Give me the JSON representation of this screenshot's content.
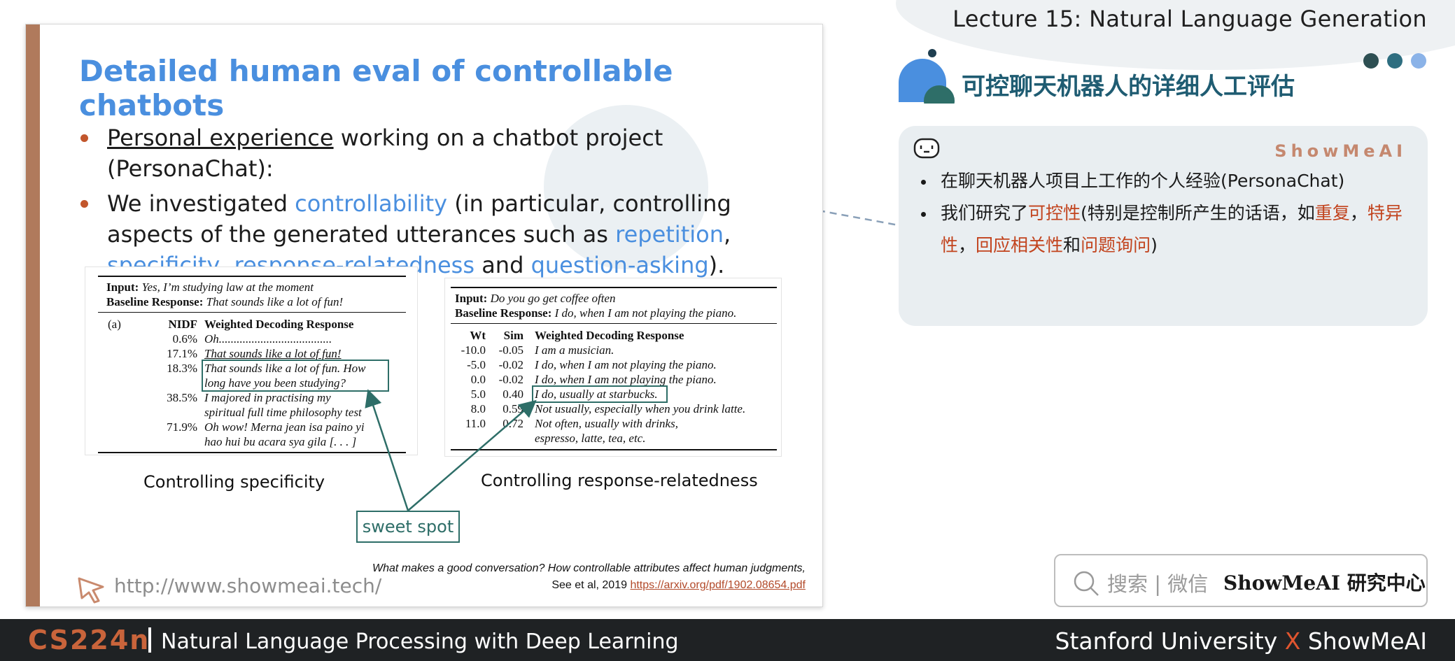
{
  "header": {
    "lecture_title": "Lecture 15: Natural Language Generation"
  },
  "slide": {
    "title": "Detailed human eval of controllable chatbots",
    "bullet1": {
      "underlined": "Personal experience",
      "rest": " working on a chatbot project (PersonaChat):"
    },
    "bullet2": {
      "t1": "We investigated ",
      "controllability": "controllability",
      "t2": " (in particular, controlling aspects of the generated utterances such as ",
      "repetition": "repetition",
      "comma1": ", ",
      "specificity": "specificity",
      "comma2": ", ",
      "relatedness": "response-relatedness",
      "and": " and ",
      "question": "question-asking",
      "end": ")."
    },
    "table_a": {
      "input_label": "Input:",
      "input_text": "Yes, I’m studying law at the moment",
      "baseline_label": "Baseline Response:",
      "baseline_text": "That sounds like a lot of fun!",
      "col_a": "(a)",
      "col_nidf": "NIDF",
      "col_resp": "Weighted Decoding Response",
      "rows": [
        {
          "nidf": "0.6%",
          "l1": "Oh......................................",
          "l2": ""
        },
        {
          "nidf": "17.1%",
          "l1": "That sounds like a lot of fun!",
          "l2": ""
        },
        {
          "nidf": "18.3%",
          "l1": "That sounds like a lot of fun. How",
          "l2": "long have you been studying?"
        },
        {
          "nidf": "38.5%",
          "l1": "I majored in practising my",
          "l2": "spiritual full time philosophy test"
        },
        {
          "nidf": "71.9%",
          "l1": "Oh wow! Merna jean isa paino yi",
          "l2": "hao hui bu acara sya gila [. . . ]"
        }
      ]
    },
    "table_b": {
      "input_label": "Input:",
      "input_text": "Do you go get coffee often",
      "baseline_label": "Baseline Response:",
      "baseline_text": "I do, when I am not playing the piano.",
      "col_wt": "Wt",
      "col_sim": "Sim",
      "col_resp": "Weighted Decoding Response",
      "rows": [
        {
          "wt": "-10.0",
          "sim": "-0.05",
          "l1": "I am a musician.",
          "l2": ""
        },
        {
          "wt": "-5.0",
          "sim": "-0.02",
          "l1": "I do, when I am not playing the piano.",
          "l2": ""
        },
        {
          "wt": "0.0",
          "sim": "-0.02",
          "l1": "I do, when I am not playing the piano.",
          "l2": ""
        },
        {
          "wt": "5.0",
          "sim": "0.40",
          "l1": "I do, usually at starbucks.",
          "l2": ""
        },
        {
          "wt": "8.0",
          "sim": "0.59",
          "l1": "Not usually, especially when you drink latte.",
          "l2": ""
        },
        {
          "wt": "11.0",
          "sim": "0.72",
          "l1": "Not often, usually with drinks,",
          "l2": "espresso, latte, tea, etc."
        }
      ]
    },
    "caption_a": "Controlling specificity",
    "caption_b": "Controlling response-relatedness",
    "sweet_spot": "sweet spot",
    "reference_line1": "What makes a good conversation? How controllable attributes affect human judgments,",
    "reference_line2": "See et al, 2019 ",
    "reference_link": "https://arxiv.org/pdf/1902.08654.pdf",
    "url": "http://www.showmeai.tech/"
  },
  "notes": {
    "cn_title": "可控聊天机器人的详细人工评估",
    "brand": "ShowMeAI",
    "item1": "在聊天机器人项目上工作的个人经验(PersonaChat)",
    "item2": {
      "t1": "我们研究了",
      "controllability": "可控性",
      "t2": "(特别是控制所产生的话语，如",
      "repetition": "重复",
      "comma1": "，",
      "specificity": "特异性",
      "comma2": "，",
      "relatedness": "回应相关性",
      "and": "和",
      "question": "问题询问",
      "end": ")"
    }
  },
  "search": {
    "label": "搜索 | 微信",
    "brand": "ShowMeAI 研究中心"
  },
  "footer": {
    "course_code": "CS224n",
    "course_name": "Natural Language Processing with Deep Learning",
    "stanford": "Stanford University ",
    "x": "X",
    "showmeai": " ShowMeAI"
  },
  "colors": {
    "title_blue": "#4a8fdf",
    "accent_orange": "#c2562c",
    "teal": "#2e6e68",
    "note_red": "#c2431d",
    "footer_bg": "#1f2224"
  }
}
